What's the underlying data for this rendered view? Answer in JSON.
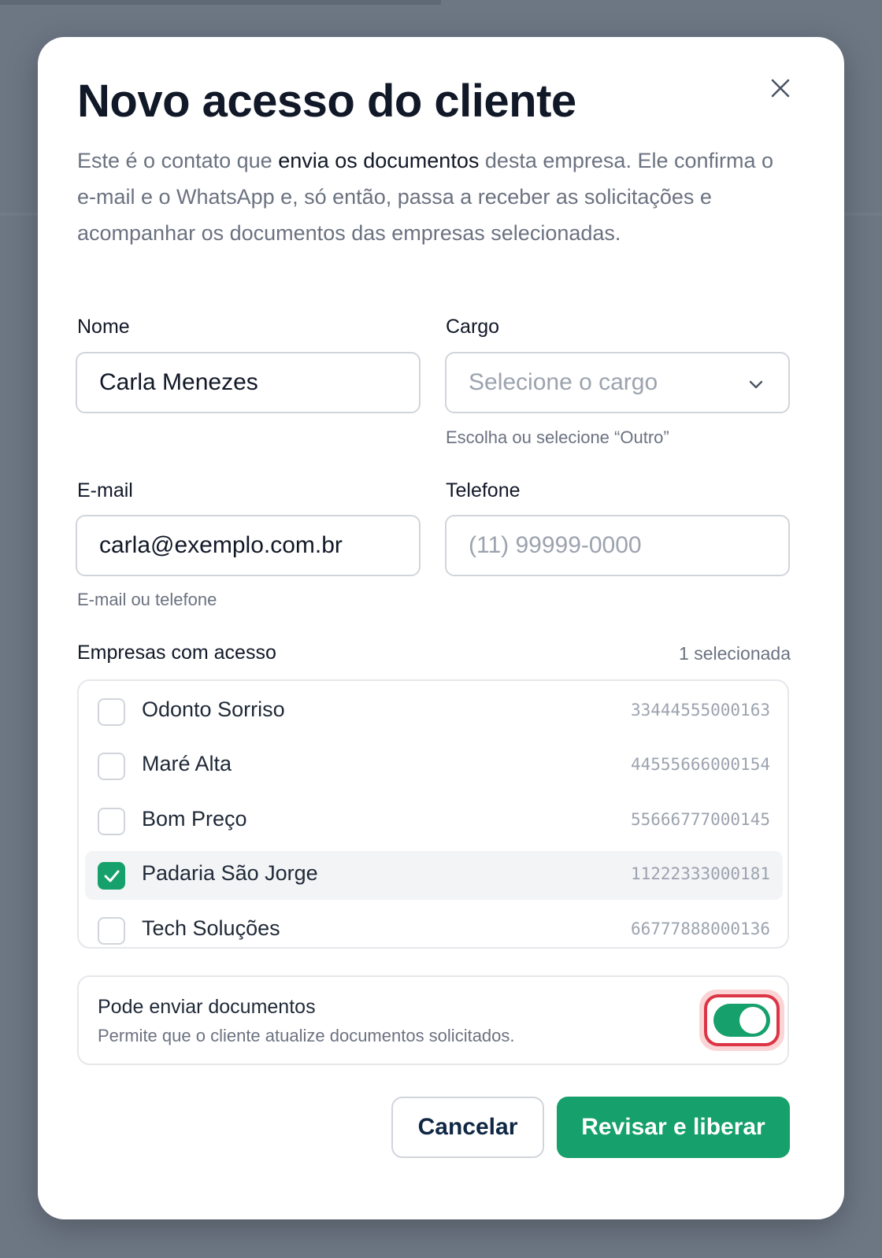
{
  "modal": {
    "title": "Novo acesso do cliente",
    "intro_before": "Este é o contato que ",
    "intro_bold": "envia os documentos",
    "intro_after": " desta empresa. Ele confirma o e-mail e o WhatsApp e, só então, passa a receber as solicitações e acompanhar os documentos das empresas selecionadas."
  },
  "form": {
    "name_label": "Nome",
    "name_value": "Carla Menezes",
    "role_label": "Cargo",
    "role_placeholder": "Selecione o cargo",
    "role_helper": "Escolha ou selecione “Outro”",
    "email_label": "E-mail",
    "email_value": "carla@exemplo.com.br",
    "email_helper": "E-mail ou telefone",
    "phone_label": "Telefone",
    "phone_placeholder": "(11) 99999-0000"
  },
  "companies": {
    "label": "Empresas com acesso",
    "count_text": "1 selecionada",
    "items": [
      {
        "name": "Odonto Sorriso",
        "cnpj": "33444555000163",
        "checked": false
      },
      {
        "name": "Maré Alta",
        "cnpj": "44555666000154",
        "checked": false
      },
      {
        "name": "Bom Preço",
        "cnpj": "55666777000145",
        "checked": false
      },
      {
        "name": "Padaria São Jorge",
        "cnpj": "11222333000181",
        "checked": true
      },
      {
        "name": "Tech Soluções",
        "cnpj": "66777888000136",
        "checked": false
      }
    ]
  },
  "permission": {
    "title": "Pode enviar documentos",
    "description": "Permite que o cliente atualize documentos solicitados.",
    "enabled": true
  },
  "actions": {
    "cancel_label": "Cancelar",
    "submit_label": "Revisar e liberar"
  },
  "colors": {
    "accent": "#16a06b",
    "focus_ring": "#dc3545"
  }
}
